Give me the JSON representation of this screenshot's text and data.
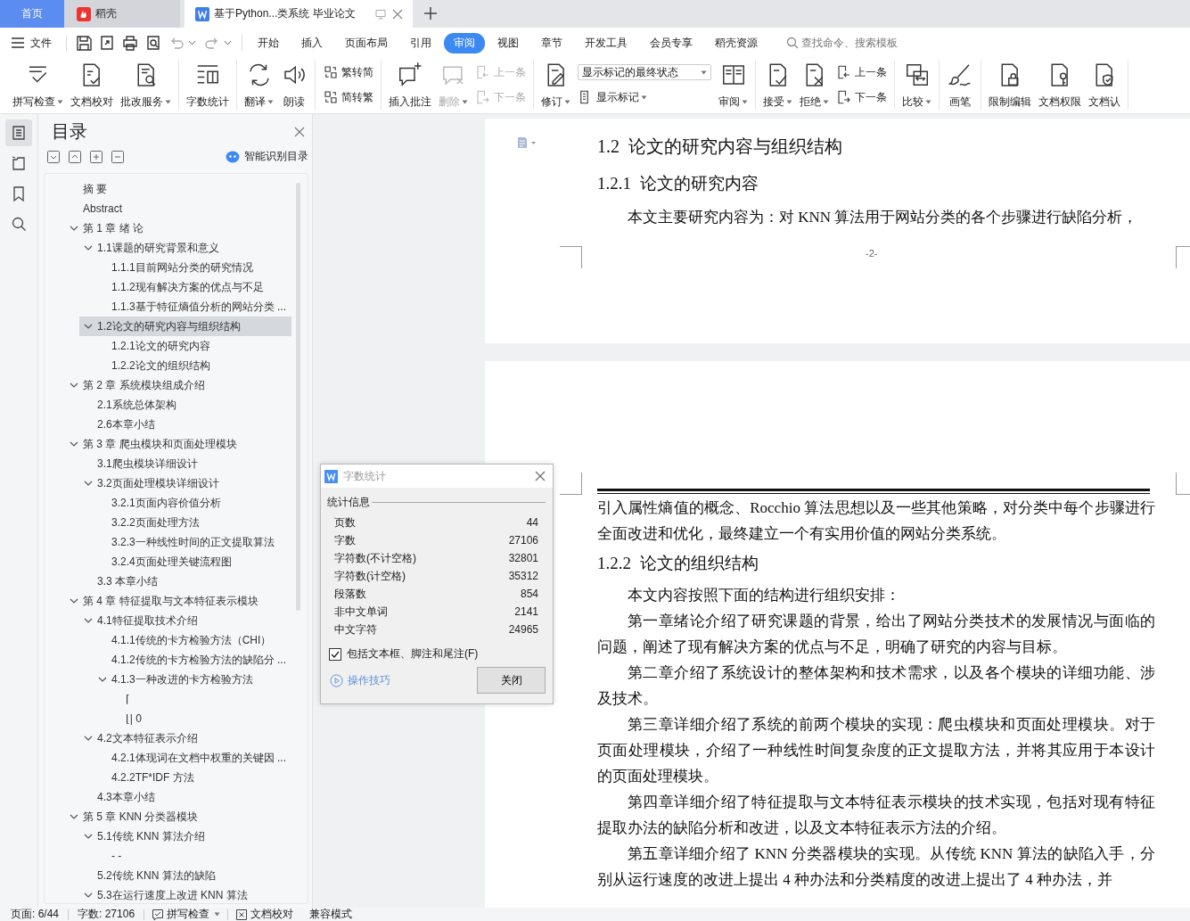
{
  "tabs": [
    {
      "kind": "home",
      "label": "首页",
      "selected": false
    },
    {
      "kind": "app",
      "label": "稻壳",
      "selected": false
    },
    {
      "kind": "doc",
      "label": "基于Python...类系统 毕业论文",
      "selected": true
    }
  ],
  "menu": {
    "file": "文件",
    "tabs": [
      {
        "label": "开始",
        "selected": false
      },
      {
        "label": "插入",
        "selected": false
      },
      {
        "label": "页面布局",
        "selected": false
      },
      {
        "label": "引用",
        "selected": false
      },
      {
        "label": "审阅",
        "selected": true
      },
      {
        "label": "视图",
        "selected": false
      },
      {
        "label": "章节",
        "selected": false
      },
      {
        "label": "开发工具",
        "selected": false
      },
      {
        "label": "会员专享",
        "selected": false
      },
      {
        "label": "稻壳资源",
        "selected": false
      }
    ],
    "search": {
      "placeholder": "查找命令、搜索模板"
    }
  },
  "ribbon": {
    "groups": [
      {
        "items": [
          {
            "kind": "large",
            "label": "拼写检查",
            "dropdown": true,
            "disabled": false
          },
          {
            "kind": "large",
            "label": "文档校对",
            "dropdown": false,
            "disabled": false
          },
          {
            "kind": "large",
            "label": "批改服务",
            "dropdown": true,
            "disabled": false
          }
        ]
      },
      {
        "items": [
          {
            "kind": "large",
            "label": "字数统计",
            "dropdown": false,
            "disabled": false
          }
        ]
      },
      {
        "items": [
          {
            "kind": "large",
            "label": "翻译",
            "dropdown": true,
            "disabled": false
          },
          {
            "kind": "large",
            "label": "朗读",
            "dropdown": false,
            "disabled": false
          }
        ]
      },
      {
        "items": [
          {
            "kind": "stack",
            "items": [
              {
                "kind": "small",
                "label": "繁转简",
                "dropdown": false,
                "disabled": false
              },
              {
                "kind": "small",
                "label": "简转繁",
                "dropdown": false,
                "disabled": false
              }
            ]
          }
        ]
      },
      {
        "items": [
          {
            "kind": "large",
            "label": "插入批注",
            "dropdown": false,
            "disabled": false
          },
          {
            "kind": "large",
            "label": "删除",
            "dropdown": true,
            "disabled": true
          },
          {
            "kind": "stack",
            "items": [
              {
                "kind": "small",
                "label": "上一条",
                "dropdown": false,
                "disabled": true
              },
              {
                "kind": "small",
                "label": "下一条",
                "dropdown": false,
                "disabled": true
              }
            ]
          }
        ]
      },
      {
        "items": [
          {
            "kind": "large",
            "label": "修订",
            "dropdown": true,
            "disabled": false
          },
          {
            "kind": "stack",
            "items": [
              {
                "kind": "select",
                "value": "显示标记的最终状态"
              },
              {
                "kind": "small",
                "label": "显示标记",
                "dropdown": true,
                "disabled": false
              }
            ]
          },
          {
            "kind": "large",
            "label": "审阅",
            "dropdown": true,
            "disabled": false
          }
        ]
      },
      {
        "items": [
          {
            "kind": "large",
            "label": "接受",
            "dropdown": true,
            "disabled": false
          },
          {
            "kind": "large",
            "label": "拒绝",
            "dropdown": true,
            "disabled": false
          },
          {
            "kind": "stack",
            "items": [
              {
                "kind": "small",
                "label": "上一条",
                "dropdown": false,
                "disabled": false
              },
              {
                "kind": "small",
                "label": "下一条",
                "dropdown": false,
                "disabled": false
              }
            ]
          }
        ]
      },
      {
        "items": [
          {
            "kind": "large",
            "label": "比较",
            "dropdown": true,
            "disabled": false
          }
        ]
      },
      {
        "items": [
          {
            "kind": "large",
            "label": "画笔",
            "dropdown": false,
            "disabled": false
          }
        ]
      },
      {
        "items": [
          {
            "kind": "large",
            "label": "限制编辑",
            "dropdown": false,
            "disabled": false
          },
          {
            "kind": "large",
            "label": "文档权限",
            "dropdown": false,
            "disabled": false
          },
          {
            "kind": "large",
            "label": "文档认",
            "dropdown": false,
            "disabled": false
          }
        ]
      }
    ]
  },
  "rail": [
    {
      "selected": true
    },
    {
      "selected": false
    },
    {
      "selected": false
    },
    {
      "selected": false
    }
  ],
  "toc": {
    "title": "目录",
    "smart_button": "智能识别目录",
    "items": [
      {
        "label": "摘 要",
        "selected": false
      },
      {
        "label": "Abstract",
        "selected": false
      },
      {
        "label": "第 1 章 绪 论",
        "selected": false,
        "expanded": true,
        "children": [
          {
            "label": "1.1课题的研究背景和意义",
            "selected": false,
            "expanded": true,
            "children": [
              {
                "label": "1.1.1目前网站分类的研究情况",
                "selected": false
              },
              {
                "label": "1.1.2现有解决方案的优点与不足",
                "selected": false
              },
              {
                "label": "1.1.3基于特征熵值分析的网站分类 ...",
                "selected": false
              }
            ]
          },
          {
            "label": "1.2论文的研究内容与组织结构",
            "selected": true,
            "expanded": true,
            "children": [
              {
                "label": "1.2.1论文的研究内容",
                "selected": false
              },
              {
                "label": "1.2.2论文的组织结构",
                "selected": false
              }
            ]
          }
        ]
      },
      {
        "label": "第 2 章 系统模块组成介绍",
        "selected": false,
        "expanded": true,
        "children": [
          {
            "label": "2.1系统总体架构",
            "selected": false
          },
          {
            "label": "2.6本章小结",
            "selected": false
          }
        ]
      },
      {
        "label": "第 3 章 爬虫模块和页面处理模块",
        "selected": false,
        "expanded": true,
        "children": [
          {
            "label": "3.1爬虫模块详细设计",
            "selected": false
          },
          {
            "label": "3.2页面处理模块详细设计",
            "selected": false,
            "expanded": true,
            "children": [
              {
                "label": "3.2.1页面内容价值分析",
                "selected": false
              },
              {
                "label": "3.2.2页面处理方法",
                "selected": false
              },
              {
                "label": "3.2.3一种线性时间的正文提取算法",
                "selected": false
              },
              {
                "label": "3.2.4页面处理关键流程图",
                "selected": false
              }
            ]
          },
          {
            "label": "3.3 本章小结",
            "selected": false
          }
        ]
      },
      {
        "label": "第 4 章 特征提取与文本特征表示模块",
        "selected": false,
        "expanded": true,
        "children": [
          {
            "label": "4.1特征提取技术介绍",
            "selected": false,
            "expanded": true,
            "children": [
              {
                "label": "4.1.1传统的卡方检验方法（CHI）",
                "selected": false
              },
              {
                "label": "4.1.2传统的卡方检验方法的缺陷分 ...",
                "selected": false
              },
              {
                "label": "4.1.3一种改进的卡方检验方法",
                "selected": false,
                "expanded": true,
                "children": [
                  {
                    "label": "⌈",
                    "selected": false
                  },
                  {
                    "label": "⌊| 0",
                    "selected": false
                  }
                ]
              }
            ]
          },
          {
            "label": "4.2文本特征表示介绍",
            "selected": false,
            "expanded": true,
            "children": [
              {
                "label": "4.2.1体现词在文档中权重的关键因 ...",
                "selected": false
              },
              {
                "label": "4.2.2TF*IDF 方法",
                "selected": false
              }
            ]
          },
          {
            "label": "4.3本章小结",
            "selected": false
          }
        ]
      },
      {
        "label": "第 5 章 KNN 分类器模块",
        "selected": false,
        "expanded": true,
        "children": [
          {
            "label": "5.1传统 KNN 算法介绍",
            "selected": false,
            "expanded": true,
            "children": [
              {
                "label": "- -",
                "selected": false
              }
            ]
          },
          {
            "label": "5.2传统 KNN 算法的缺陷",
            "selected": false
          },
          {
            "label": "5.3在运行速度上改进 KNN 算法",
            "selected": false,
            "expanded": true
          }
        ]
      }
    ]
  },
  "document": {
    "pages": [
      {
        "blocks": [
          {
            "kind": "heading1",
            "text": "1.2  论文的研究内容与组织结构"
          },
          {
            "kind": "heading2",
            "text": "1.2.1  论文的研究内容"
          },
          {
            "kind": "paragraph",
            "indent": true,
            "text": "本文主要研究内容为：对 KNN 算法用于网站分类的各个步骤进行缺陷分析，"
          }
        ],
        "footer": "-2-"
      },
      {
        "header_rule": true,
        "blocks": [
          {
            "kind": "paragraph",
            "indent": false,
            "text": "引入属性熵值的概念、Rocchio 算法思想以及一些其他策略，对分类中每个步骤进行全面改进和优化，最终建立一个有实用价值的网站分类系统。"
          },
          {
            "kind": "heading2",
            "text": "1.2.2  论文的组织结构"
          },
          {
            "kind": "paragraph",
            "indent": true,
            "text": "本文内容按照下面的结构进行组织安排："
          },
          {
            "kind": "paragraph",
            "indent": true,
            "text": "第一章绪论介绍了研究课题的背景，给出了网站分类技术的发展情况与面临的问题，阐述了现有解决方案的优点与不足，明确了研究的内容与目标。"
          },
          {
            "kind": "paragraph",
            "indent": true,
            "text": "第二章介绍了系统设计的整体架构和技术需求，以及各个模块的详细功能、涉及技术。"
          },
          {
            "kind": "paragraph",
            "indent": true,
            "text": "第三章详细介绍了系统的前两个模块的实现：爬虫模块和页面处理模块。对于页面处理模块，介绍了一种线性时间复杂度的正文提取方法，并将其应用于本设计的页面处理模块。"
          },
          {
            "kind": "paragraph",
            "indent": true,
            "text": "第四章详细介绍了特征提取与文本特征表示模块的技术实现，包括对现有特征提取办法的缺陷分析和改进，以及文本特征表示方法的介绍。"
          },
          {
            "kind": "paragraph",
            "indent": true,
            "text": "第五章详细介绍了 KNN 分类器模块的实现。从传统 KNN 算法的缺陷入手，分别从运行速度的改进上提出 4 种办法和分类精度的改进上提出了 4 种办法，并"
          }
        ]
      }
    ]
  },
  "dialog": {
    "title": "字数统计",
    "section": "统计信息",
    "rows": [
      {
        "label": "页数",
        "value": "44"
      },
      {
        "label": "字数",
        "value": "27106"
      },
      {
        "label": "字符数(不计空格)",
        "value": "32801"
      },
      {
        "label": "字符数(计空格)",
        "value": "35312"
      },
      {
        "label": "段落数",
        "value": "854"
      },
      {
        "label": "非中文单词",
        "value": "2141"
      },
      {
        "label": "中文字符",
        "value": "24965"
      }
    ],
    "checkbox": {
      "label": "包括文本框、脚注和尾注(F)",
      "checked": true
    },
    "tips_link": "操作技巧",
    "close_button": "关闭"
  },
  "status_bar": [
    {
      "kind": "text",
      "label": "页面: 6/44"
    },
    {
      "kind": "text",
      "label": "字数: 27106"
    },
    {
      "kind": "tool",
      "label": "拼写检查",
      "dropdown": true
    },
    {
      "kind": "tool",
      "label": "文档校对",
      "dropdown": false
    },
    {
      "kind": "text",
      "label": "兼容模式"
    }
  ]
}
